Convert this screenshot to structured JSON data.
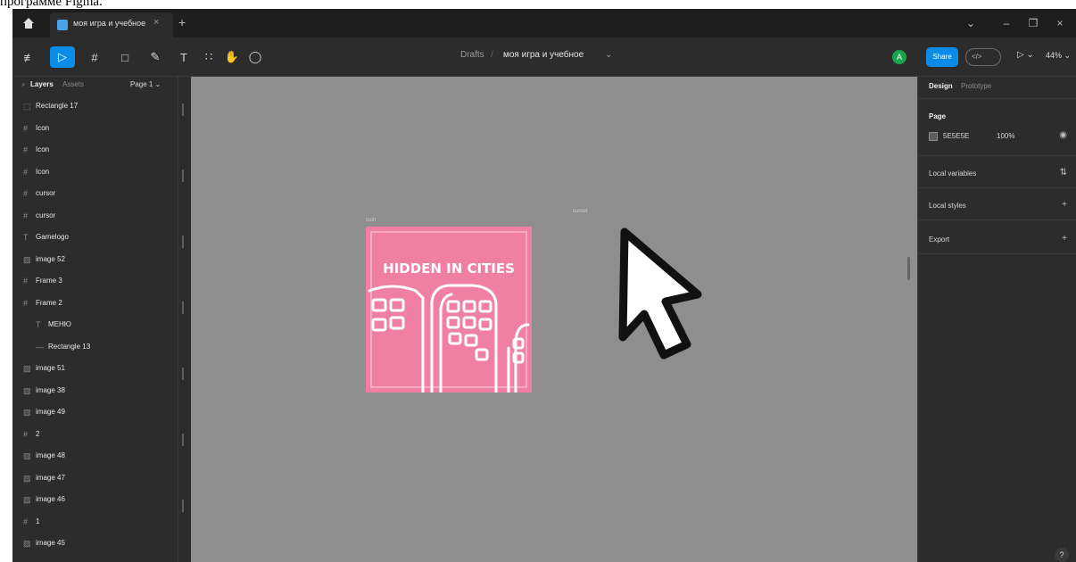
{
  "caption": "программе Figma.",
  "tab": {
    "title": "моя игра и учебное",
    "close": "×",
    "add": "+"
  },
  "window_controls": {
    "bell": "⌄",
    "minimize": "–",
    "restore": "❐",
    "close": "×"
  },
  "toolbar": {
    "main_menu": "≢",
    "tools": [
      "▷",
      "#",
      "□",
      "✎",
      "T",
      "∷",
      "✋",
      "◯"
    ],
    "breadcrumb_folder": "Drafts",
    "breadcrumb_sep": "/",
    "breadcrumb_file": "моя игра и учебное",
    "breadcrumb_chevron": "⌄",
    "avatar": "A",
    "share": "Share",
    "dev_mode": "</>",
    "play": "▷ ⌄",
    "zoom": "44% ⌄"
  },
  "left_panel": {
    "tabs": {
      "layers": "Layers",
      "assets": "Assets",
      "page": "Page 1 ⌄"
    },
    "layers": [
      {
        "icon": "⬚",
        "name": "Rectangle 17",
        "indent": 0
      },
      {
        "icon": "#",
        "name": "Icon",
        "indent": 0
      },
      {
        "icon": "#",
        "name": "Icon",
        "indent": 0
      },
      {
        "icon": "#",
        "name": "Icon",
        "indent": 0
      },
      {
        "icon": "#",
        "name": "cursor",
        "indent": 0
      },
      {
        "icon": "#",
        "name": "cursor",
        "indent": 0
      },
      {
        "icon": "T",
        "name": "Gamelogo",
        "indent": 0
      },
      {
        "icon": "▨",
        "name": "image 52",
        "indent": 0
      },
      {
        "icon": "#",
        "name": "Frame 3",
        "indent": 0
      },
      {
        "icon": "#",
        "name": "Frame 2",
        "indent": 0
      },
      {
        "icon": "T",
        "name": "МЕНЮ",
        "indent": 1
      },
      {
        "icon": "—",
        "name": "Rectangle 13",
        "indent": 1
      },
      {
        "icon": "▨",
        "name": "image 51",
        "indent": 0
      },
      {
        "icon": "▨",
        "name": "image 38",
        "indent": 0
      },
      {
        "icon": "▨",
        "name": "image 49",
        "indent": 0
      },
      {
        "icon": "#",
        "name": "2",
        "indent": 0
      },
      {
        "icon": "▨",
        "name": "image 48",
        "indent": 0
      },
      {
        "icon": "▨",
        "name": "image 47",
        "indent": 0
      },
      {
        "icon": "▨",
        "name": "image 46",
        "indent": 0
      },
      {
        "icon": "#",
        "name": "1",
        "indent": 0
      },
      {
        "icon": "▨",
        "name": "image 45",
        "indent": 0
      }
    ]
  },
  "canvas": {
    "ruler_ticks": [
      "-300",
      "-200",
      "-100",
      "0",
      "100",
      "200",
      "300",
      "400",
      "500",
      "600",
      "700",
      "800",
      "900"
    ],
    "art_frame_label": "Icon",
    "cursor_frame_label": "cursor",
    "art_title": "HIDDEN IN CITIES"
  },
  "right_panel": {
    "tabs": {
      "design": "Design",
      "prototype": "Prototype"
    },
    "page_label": "Page",
    "page_color": "5E5E5E",
    "page_opacity": "100%",
    "eye": "◉",
    "local_variables": "Local variables",
    "local_styles": "Local styles",
    "export": "Export",
    "plus": "+"
  },
  "colors": {
    "canvas": "#8e8e8e",
    "accent": "#0c8ce9",
    "art_pink": "#ef7fa3"
  },
  "help": "?"
}
